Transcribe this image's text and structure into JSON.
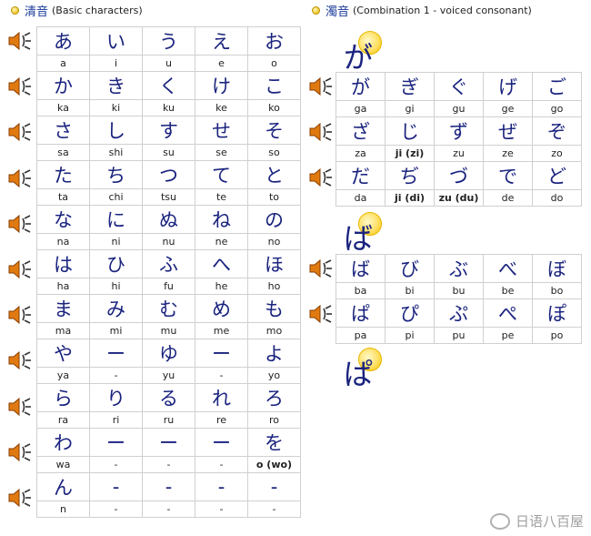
{
  "left": {
    "title_kanji": "清音",
    "title_sub": "(Basic characters)",
    "rows": [
      {
        "kana": [
          "あ",
          "い",
          "う",
          "え",
          "お"
        ],
        "roma": [
          "a",
          "i",
          "u",
          "e",
          "o"
        ]
      },
      {
        "kana": [
          "か",
          "き",
          "く",
          "け",
          "こ"
        ],
        "roma": [
          "ka",
          "ki",
          "ku",
          "ke",
          "ko"
        ]
      },
      {
        "kana": [
          "さ",
          "し",
          "す",
          "せ",
          "そ"
        ],
        "roma": [
          "sa",
          "shi",
          "su",
          "se",
          "so"
        ]
      },
      {
        "kana": [
          "た",
          "ち",
          "つ",
          "て",
          "と"
        ],
        "roma": [
          "ta",
          "chi",
          "tsu",
          "te",
          "to"
        ]
      },
      {
        "kana": [
          "な",
          "に",
          "ぬ",
          "ね",
          "の"
        ],
        "roma": [
          "na",
          "ni",
          "nu",
          "ne",
          "no"
        ]
      },
      {
        "kana": [
          "は",
          "ひ",
          "ふ",
          "へ",
          "ほ"
        ],
        "roma": [
          "ha",
          "hi",
          "fu",
          "he",
          "ho"
        ]
      },
      {
        "kana": [
          "ま",
          "み",
          "む",
          "め",
          "も"
        ],
        "roma": [
          "ma",
          "mi",
          "mu",
          "me",
          "mo"
        ]
      },
      {
        "kana": [
          "や",
          "ー",
          "ゆ",
          "ー",
          "よ"
        ],
        "roma": [
          "ya",
          "-",
          "yu",
          "-",
          "yo"
        ]
      },
      {
        "kana": [
          "ら",
          "り",
          "る",
          "れ",
          "ろ"
        ],
        "roma": [
          "ra",
          "ri",
          "ru",
          "re",
          "ro"
        ]
      },
      {
        "kana": [
          "わ",
          "ー",
          "ー",
          "ー",
          "を"
        ],
        "roma": [
          "wa",
          "-",
          "-",
          "-",
          "o (wo)"
        ]
      },
      {
        "kana": [
          "ん",
          "-",
          "-",
          "-",
          "-"
        ],
        "roma": [
          "n",
          "-",
          "-",
          "-",
          "-"
        ]
      }
    ]
  },
  "right": {
    "title_kanji": "濁音",
    "title_sub": "(Combination 1 - voiced consonant)",
    "marker_ga": "が",
    "marker_ba": "ば",
    "marker_pa": "ぱ",
    "group1": [
      {
        "kana": [
          "が",
          "ぎ",
          "ぐ",
          "げ",
          "ご"
        ],
        "roma": [
          "ga",
          "gi",
          "gu",
          "ge",
          "go"
        ]
      },
      {
        "kana": [
          "ざ",
          "じ",
          "ず",
          "ぜ",
          "ぞ"
        ],
        "roma": [
          "za",
          "ji (zi)",
          "zu",
          "ze",
          "zo"
        ]
      },
      {
        "kana": [
          "だ",
          "ぢ",
          "づ",
          "で",
          "ど"
        ],
        "roma": [
          "da",
          "ji (di)",
          "zu (du)",
          "de",
          "do"
        ]
      }
    ],
    "group2": [
      {
        "kana": [
          "ば",
          "び",
          "ぶ",
          "べ",
          "ぼ"
        ],
        "roma": [
          "ba",
          "bi",
          "bu",
          "be",
          "bo"
        ]
      },
      {
        "kana": [
          "ぱ",
          "ぴ",
          "ぷ",
          "ぺ",
          "ぽ"
        ],
        "roma": [
          "pa",
          "pi",
          "pu",
          "pe",
          "po"
        ]
      }
    ]
  },
  "watermark": "日语八百屋",
  "icons": {
    "speaker": "speaker-icon",
    "bullet": "bullet-dot-icon"
  }
}
